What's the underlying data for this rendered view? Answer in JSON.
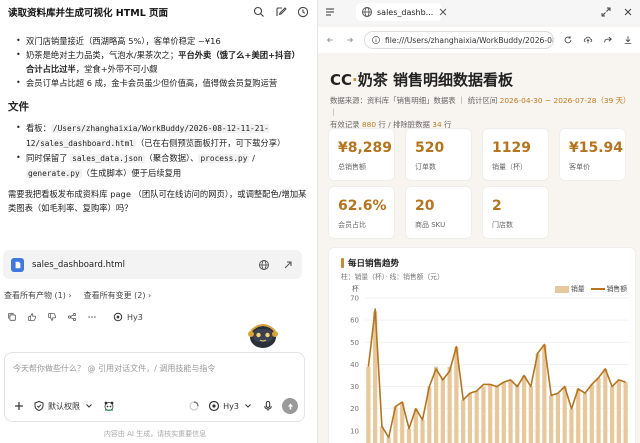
{
  "left": {
    "title": "读取资料库并生成可视化 HTML 页面",
    "bullets_top": [
      {
        "text": "双门店销量接近（西湖略高 5%），客单价稳定 ~¥16"
      },
      {
        "text_a": "奶茶是绝对主力品类，气泡水/果茶次之；",
        "text_b": "平台外卖（饿了么+美团+抖音）合计占比过半",
        "text_c": "，堂食+外带不可小觑"
      },
      {
        "text": "会员订单占比超 6 成，金卡会员虽少但价值高，值得做会员复购运营"
      }
    ],
    "file_heading": "文件",
    "file_bullets": [
      {
        "prefix": "看板：",
        "path": "/Users/zhanghaixia/WorkBuddy/2026-08-12-11-21-12/sales_dashboard.html",
        "suffix": "（已在右侧预览面板打开，可下载分享）"
      },
      {
        "prefix": "同时保留了 ",
        "file1": "sales_data.json",
        "mid1": "（聚合数据）、",
        "file2": "process.py",
        "mid2": " / ",
        "file3": "generate.py",
        "suffix": "（生成脚本）便于后续复用"
      }
    ],
    "question": "需要我把看板发布成资料库 page （团队可在线访问的网页），或调整配色/增加某类图表（如毛利率、复购率）吗？",
    "file_card": {
      "name": "sales_dashboard.html"
    },
    "view_products": "查看所有产物 (1) ›",
    "view_changes": "查看所有变更 (2) ›",
    "model_name": "Hy3",
    "composer": {
      "placeholder": "今天帮你做些什么？ @ 引用对话文件，/ 调用技能与指令",
      "permission": "默认权限",
      "model": "Hy3"
    },
    "footnote": "内容由 AI 生成，请核实重要信息"
  },
  "right": {
    "tab_title": "sales_dashb...",
    "url": "file:///Users/zhanghaixia/WorkBuddy/2026-08-12-",
    "dash": {
      "title_prefix": "CC",
      "title_dot": "·",
      "title_rest": "奶茶 销售明细数据看板",
      "meta_line1_a": "数据来源：资料库「销售明细」数据表 ｜ 统计区间 ",
      "meta_range": "2026-04-30 ~ 2026-07-28（39 天）",
      "meta_line1_b": " ｜",
      "meta_line2_a": "有效记录 ",
      "meta_valid": "880",
      "meta_line2_b": " 行 / 排除脏数据 ",
      "meta_dirty": "34",
      "meta_line2_c": " 行"
    },
    "kpis": [
      {
        "value": "¥8,289",
        "label": "总销售额"
      },
      {
        "value": "520",
        "label": "订单数"
      },
      {
        "value": "1129",
        "label": "销量（杯）"
      },
      {
        "value": "¥15.94",
        "label": "客单价"
      },
      {
        "value": "62.6%",
        "label": "会员占比"
      },
      {
        "value": "20",
        "label": "商品 SKU"
      },
      {
        "value": "2",
        "label": "门店数"
      }
    ],
    "chart_title": "每日销售趋势",
    "chart_subtitle": "柱：销量（杯）· 线：销售额（元）",
    "axis_unit": "杯",
    "legend_bar": "销量",
    "legend_line": "销售额"
  },
  "chart_data": {
    "type": "bar",
    "title": "每日销售趋势",
    "subtitle": "柱：销量（杯）· 线：销售额（元）",
    "ylabel": "杯",
    "ylim": [
      0,
      70
    ],
    "yticks": [
      0,
      10,
      20,
      30,
      40,
      50,
      60,
      70
    ],
    "legend_position": "top-right",
    "series": [
      {
        "name": "销量",
        "type": "bar",
        "values": [
          39,
          64,
          12,
          7,
          21,
          23,
          11,
          20,
          15,
          30,
          39,
          34,
          39,
          48,
          24,
          27,
          28,
          30,
          31,
          30,
          32,
          33,
          31,
          35,
          30,
          45,
          49,
          26,
          27,
          30,
          20,
          29,
          27,
          31,
          34,
          38,
          30,
          33,
          32
        ]
      },
      {
        "name": "销售额",
        "type": "line",
        "values": [
          39,
          65,
          12,
          7,
          21,
          23,
          11,
          20,
          15,
          30,
          38,
          33,
          37,
          48,
          24,
          27,
          28,
          31,
          31,
          30,
          32,
          33,
          30,
          35,
          30,
          45,
          49,
          26,
          27,
          30,
          20,
          29,
          27,
          31,
          34,
          38,
          30,
          33,
          32
        ]
      }
    ],
    "colors": {
      "bar": "#e8c79a",
      "line": "#b5741d"
    }
  }
}
